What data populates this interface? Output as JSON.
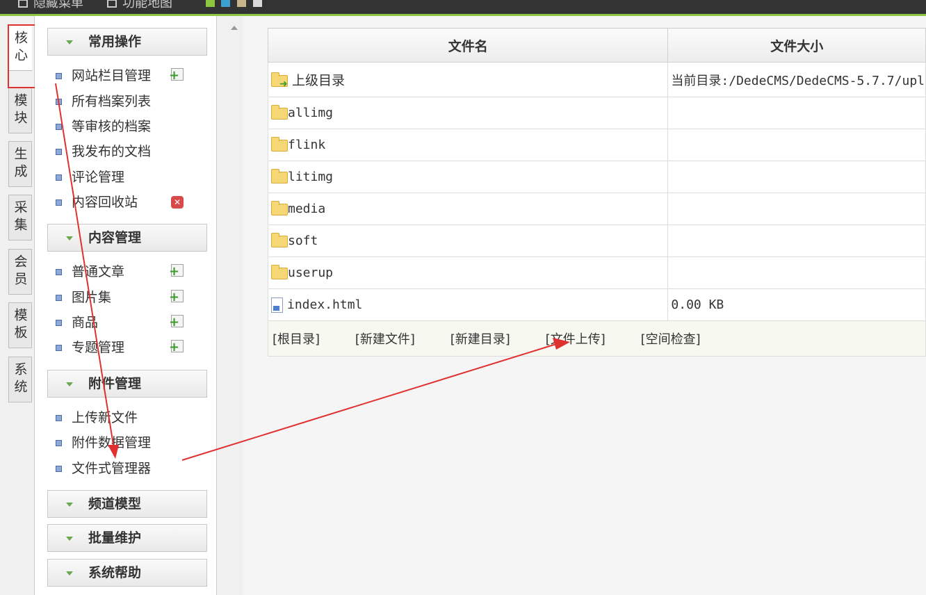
{
  "topbar": {
    "hide_menu": "隐藏菜单",
    "site_map": "功能地图",
    "swatches": [
      "#8cc63f",
      "#3ca0d0",
      "#c8b68a",
      "#d8d8d8"
    ]
  },
  "vtabs": [
    {
      "label": "核心",
      "active": true
    },
    {
      "label": "模块"
    },
    {
      "label": "生成"
    },
    {
      "label": "采集"
    },
    {
      "label": "会员"
    },
    {
      "label": "模板"
    },
    {
      "label": "系统"
    }
  ],
  "menu": {
    "sections": [
      {
        "title": "常用操作",
        "items": [
          {
            "label": "网站栏目管理",
            "icon": "add-icon"
          },
          {
            "label": "所有档案列表"
          },
          {
            "label": "等审核的档案"
          },
          {
            "label": "我发布的文档"
          },
          {
            "label": "评论管理"
          },
          {
            "label": "内容回收站",
            "icon": "delete-icon"
          }
        ]
      },
      {
        "title": "内容管理",
        "items": [
          {
            "label": "普通文章",
            "icon": "add-icon"
          },
          {
            "label": "图片集",
            "icon": "add-icon"
          },
          {
            "label": "商品",
            "icon": "add-icon"
          },
          {
            "label": "专题管理",
            "icon": "add-icon"
          }
        ]
      },
      {
        "title": "附件管理",
        "items": [
          {
            "label": "上传新文件"
          },
          {
            "label": "附件数据管理"
          },
          {
            "label": "文件式管理器"
          }
        ]
      },
      {
        "title": "频道模型",
        "items": []
      },
      {
        "title": "批量维护",
        "items": []
      },
      {
        "title": "系统帮助",
        "items": []
      }
    ]
  },
  "filetable": {
    "headers": [
      "文件名",
      "文件大小"
    ],
    "parent": {
      "name": "上级目录",
      "info": "当前目录:/DedeCMS/DedeCMS-5.7.7/upl"
    },
    "folders": [
      "allimg",
      "flink",
      "litimg",
      "media",
      "soft",
      "userup"
    ],
    "file": {
      "name": "index.html",
      "size": "0.00 KB"
    },
    "actions": [
      "[根目录]",
      "[新建文件]",
      "[新建目录]",
      "[文件上传]",
      "[空间检查]"
    ]
  },
  "colors": {
    "accent": "#8cc63f",
    "annotation": "#e03030"
  }
}
